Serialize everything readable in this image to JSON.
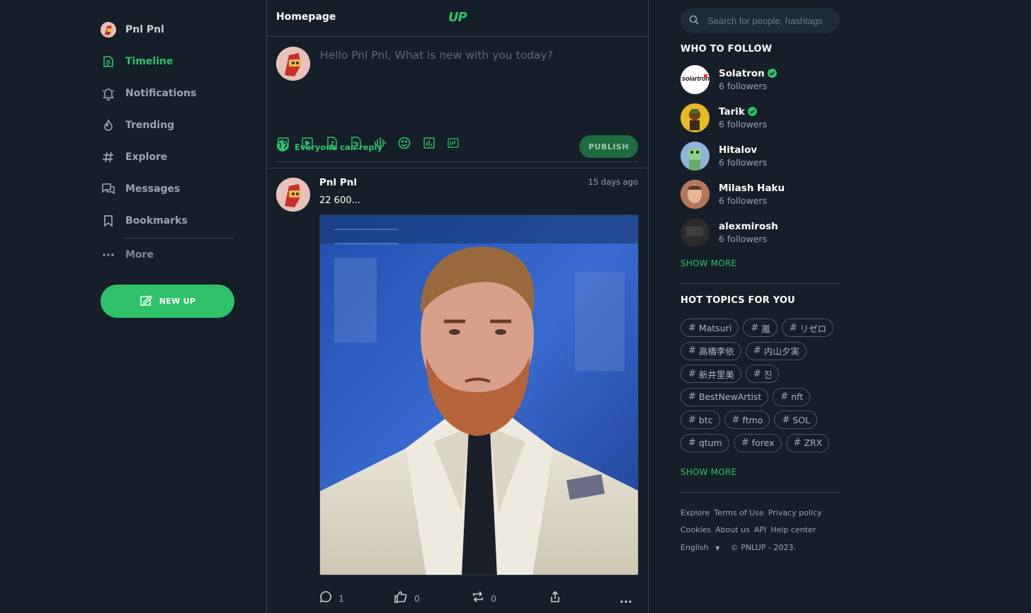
{
  "sidebar": {
    "profile_name": "Pnl Pnl",
    "items": [
      {
        "label": "Timeline",
        "icon": "timeline-icon",
        "active": true
      },
      {
        "label": "Notifications",
        "icon": "bell-icon",
        "active": false
      },
      {
        "label": "Trending",
        "icon": "fire-icon",
        "active": false
      },
      {
        "label": "Explore",
        "icon": "hashtag-icon",
        "active": false
      },
      {
        "label": "Messages",
        "icon": "messages-icon",
        "active": false
      },
      {
        "label": "Bookmarks",
        "icon": "bookmark-icon",
        "active": false
      }
    ],
    "more_label": "More",
    "new_up_label": "NEW UP"
  },
  "header": {
    "title": "Homepage",
    "brand": "UP"
  },
  "composer": {
    "placeholder": "Hello Pnl Pnl, What is new with you today?",
    "tools": [
      "image-icon",
      "video-icon",
      "audio-file-icon",
      "document-icon",
      "voice-icon",
      "emoji-icon",
      "poll-icon",
      "gif-icon"
    ],
    "reply_setting": "Everyone can reply",
    "publish_label": "PUBLISH"
  },
  "post": {
    "author": "Pnl Pnl",
    "time": "15 days ago",
    "text": "22 600...",
    "comments": "1",
    "likes": "0",
    "reposts": "0"
  },
  "right": {
    "search_placeholder": "Search for people, hashtags",
    "who_to_follow_title": "WHO TO FOLLOW",
    "follow": [
      {
        "name": "Solatron",
        "followers": "6 followers",
        "verified": true
      },
      {
        "name": "Tarik",
        "followers": "6 followers",
        "verified": true
      },
      {
        "name": "Hitalov",
        "followers": "6 followers",
        "verified": false
      },
      {
        "name": "Milash Haku",
        "followers": "6 followers",
        "verified": false
      },
      {
        "name": "alexmirosh",
        "followers": "6 followers",
        "verified": false
      }
    ],
    "solatron_logo_text": "solartron",
    "show_more": "SHOW MORE",
    "hot_topics_title": "HOT TOPICS FOR YOU",
    "tags": [
      "Matsuri",
      "嵐",
      "リゼロ",
      "高橋李依",
      "内山夕実",
      "新井里美",
      "진",
      "BestNewArtist",
      "nft",
      "btc",
      "ftmo",
      "SOL",
      "qtum",
      "forex",
      "ZRX"
    ],
    "show_more_topics": "SHOW MORE",
    "footer": {
      "links_row1": [
        "Explore",
        "Terms of Use",
        "Privacy policy"
      ],
      "links_row2": [
        "Cookies",
        "About us",
        "API",
        "Help center"
      ],
      "language": "English",
      "copyright": "© PNLUP - 2023."
    }
  },
  "colors": {
    "accent": "#2fc26a",
    "background": "#151e29",
    "border": "#3a4552",
    "muted_text": "#9aa5b1"
  }
}
